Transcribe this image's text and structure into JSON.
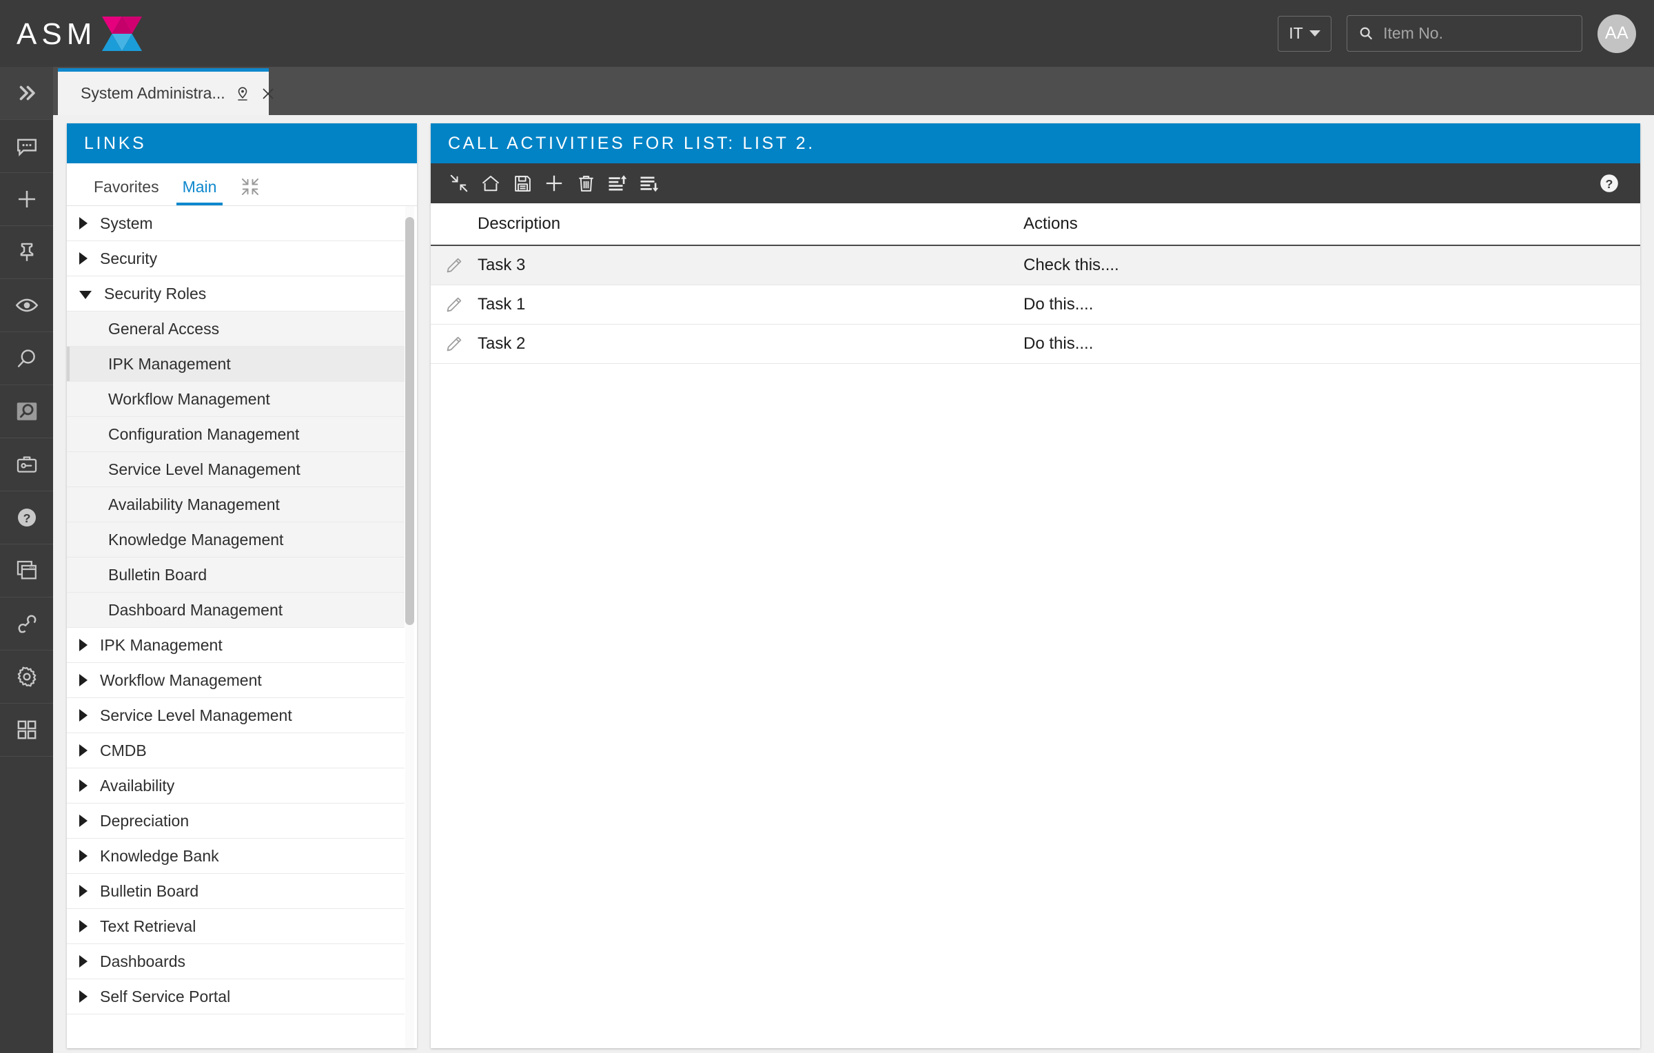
{
  "header": {
    "logo_text": "ASM",
    "logo_colors": {
      "top": "#e6007e",
      "top_dark": "#c5006b",
      "bottom": "#1b9dd9",
      "bottom_light": "#45b4e5"
    },
    "language": "IT",
    "search_placeholder": "Item No.",
    "search_value": "",
    "avatar_initials": "AA"
  },
  "rail": {
    "items": [
      {
        "icon": "chevron-double-right-icon",
        "name": "expand-menu"
      },
      {
        "icon": "chat-icon",
        "name": "messages"
      },
      {
        "icon": "plus-icon",
        "name": "new-item"
      },
      {
        "icon": "pin-icon",
        "name": "pinned"
      },
      {
        "icon": "eye-icon",
        "name": "watch"
      },
      {
        "icon": "magnifier-icon",
        "name": "search"
      },
      {
        "icon": "magnifier-box-icon",
        "name": "advanced-search"
      },
      {
        "icon": "toolbox-icon",
        "name": "system-administration"
      },
      {
        "icon": "help-circle-icon",
        "name": "help"
      },
      {
        "icon": "windows-icon",
        "name": "open-windows"
      },
      {
        "icon": "phone-icon",
        "name": "calls"
      },
      {
        "icon": "gear-icon",
        "name": "settings"
      },
      {
        "icon": "grid-icon",
        "name": "apps"
      }
    ]
  },
  "tab": {
    "icon": "toolbox-icon",
    "title": "System Administra...",
    "pin_icon": "map-pin-icon",
    "close_icon": "close-icon"
  },
  "links_panel": {
    "title": "LINKS",
    "tabs": [
      {
        "label": "Favorites",
        "active": false
      },
      {
        "label": "Main",
        "active": true
      }
    ],
    "collapse_icon": "collapse-all-icon",
    "tree": [
      {
        "label": "System",
        "level": 0,
        "state": "closed",
        "selected": false
      },
      {
        "label": "Security",
        "level": 0,
        "state": "closed",
        "selected": false
      },
      {
        "label": "Security Roles",
        "level": 0,
        "state": "open",
        "selected": false
      },
      {
        "label": "General Access",
        "level": 1,
        "state": "leaf",
        "selected": false
      },
      {
        "label": "IPK Management",
        "level": 1,
        "state": "leaf",
        "selected": true
      },
      {
        "label": "Workflow Management",
        "level": 1,
        "state": "leaf",
        "selected": false
      },
      {
        "label": "Configuration Management",
        "level": 1,
        "state": "leaf",
        "selected": false
      },
      {
        "label": "Service Level Management",
        "level": 1,
        "state": "leaf",
        "selected": false
      },
      {
        "label": "Availability Management",
        "level": 1,
        "state": "leaf",
        "selected": false
      },
      {
        "label": "Knowledge Management",
        "level": 1,
        "state": "leaf",
        "selected": false
      },
      {
        "label": "Bulletin Board",
        "level": 1,
        "state": "leaf",
        "selected": false
      },
      {
        "label": "Dashboard Management",
        "level": 1,
        "state": "leaf",
        "selected": false
      },
      {
        "label": "IPK Management",
        "level": 0,
        "state": "closed",
        "selected": false
      },
      {
        "label": "Workflow Management",
        "level": 0,
        "state": "closed",
        "selected": false
      },
      {
        "label": "Service Level Management",
        "level": 0,
        "state": "closed",
        "selected": false
      },
      {
        "label": "CMDB",
        "level": 0,
        "state": "closed",
        "selected": false
      },
      {
        "label": "Availability",
        "level": 0,
        "state": "closed",
        "selected": false
      },
      {
        "label": "Depreciation",
        "level": 0,
        "state": "closed",
        "selected": false
      },
      {
        "label": "Knowledge Bank",
        "level": 0,
        "state": "closed",
        "selected": false
      },
      {
        "label": "Bulletin Board",
        "level": 0,
        "state": "closed",
        "selected": false
      },
      {
        "label": "Text Retrieval",
        "level": 0,
        "state": "closed",
        "selected": false
      },
      {
        "label": "Dashboards",
        "level": 0,
        "state": "closed",
        "selected": false
      },
      {
        "label": "Self Service Portal",
        "level": 0,
        "state": "closed",
        "selected": false
      }
    ]
  },
  "main_panel": {
    "title": "CALL ACTIVITIES FOR LIST: LIST 2.",
    "toolbar": [
      {
        "icon": "collapse-icon",
        "name": "collapse"
      },
      {
        "icon": "home-icon",
        "name": "home"
      },
      {
        "icon": "save-icon",
        "name": "save"
      },
      {
        "icon": "plus-icon",
        "name": "add"
      },
      {
        "icon": "trash-icon",
        "name": "delete"
      },
      {
        "icon": "move-up-icon",
        "name": "move-up"
      },
      {
        "icon": "move-down-icon",
        "name": "move-down"
      }
    ],
    "help_icon": "help-circle-icon",
    "table": {
      "columns": [
        "Description",
        "Actions"
      ],
      "rows": [
        {
          "edit_icon": "pencil-icon",
          "description": "Task 3",
          "actions": "Check this....",
          "selected": true
        },
        {
          "edit_icon": "pencil-icon",
          "description": "Task 1",
          "actions": "Do this....",
          "selected": false
        },
        {
          "edit_icon": "pencil-icon",
          "description": "Task 2",
          "actions": "Do this....",
          "selected": false
        }
      ]
    }
  },
  "colors": {
    "accent_blue": "#0283c6",
    "tab_blue": "#0e88cd",
    "header_dark": "#3b3b3b",
    "page_bg": "#f0f0f0"
  }
}
